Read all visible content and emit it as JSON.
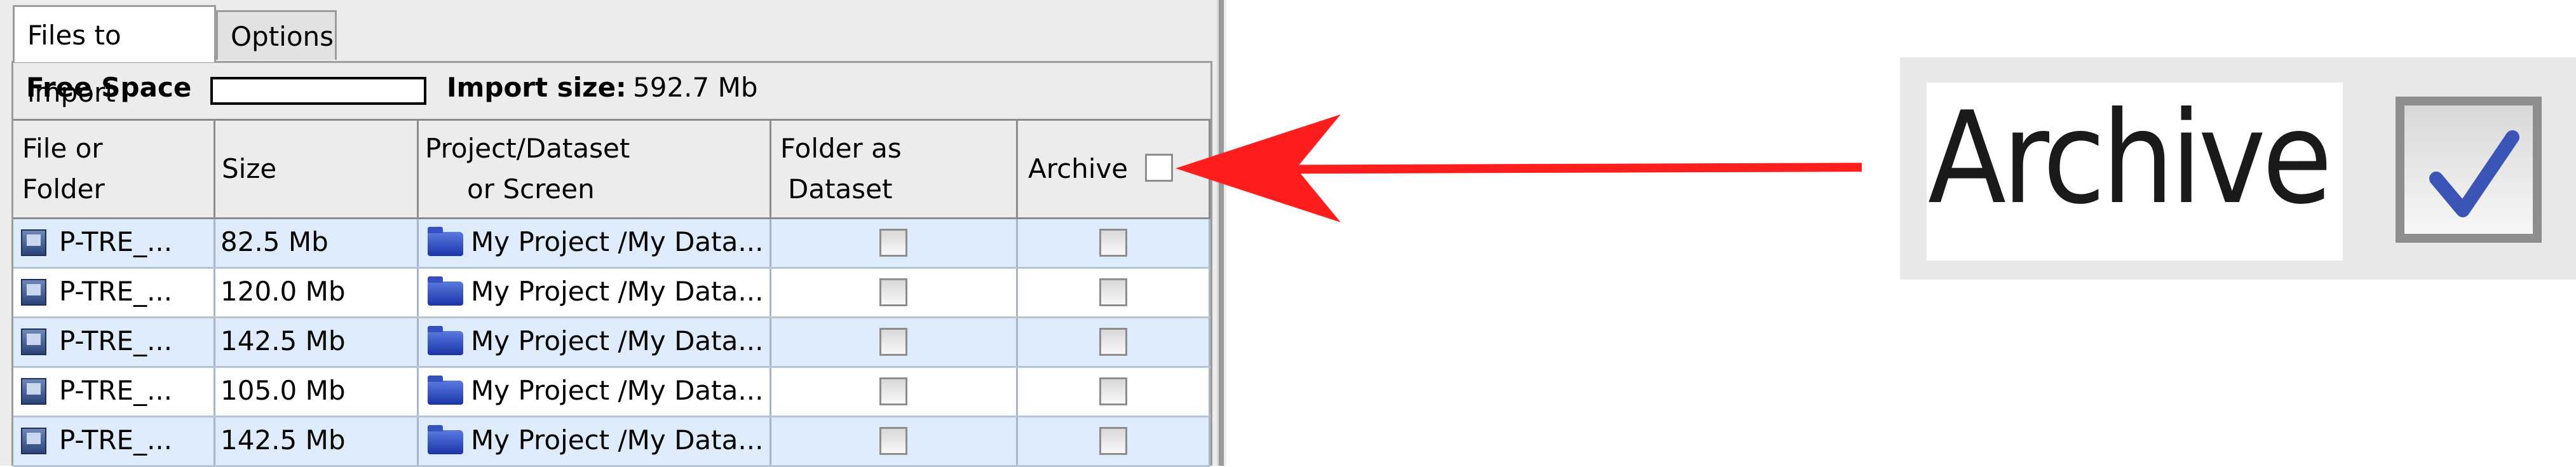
{
  "tabs": [
    {
      "label": "Files to import",
      "active": true
    },
    {
      "label": "Options",
      "active": false
    }
  ],
  "summary": {
    "free_space_label": "Free Space",
    "import_size_label": "Import size:",
    "import_size_value": "592.7 Mb"
  },
  "columns": {
    "file_line1": "File or",
    "file_line2": "Folder",
    "size": "Size",
    "project_line1": "Project/Dataset",
    "project_line2": "or Screen",
    "folder_line1": "Folder as",
    "folder_line2": "Dataset",
    "archive": "Archive"
  },
  "rows": [
    {
      "file": "P-TRE_...",
      "size": "82.5 Mb",
      "target": "My Project /My Data...",
      "folder_as_dataset": false,
      "archive": false
    },
    {
      "file": "P-TRE_...",
      "size": "120.0 Mb",
      "target": "My Project /My Data...",
      "folder_as_dataset": false,
      "archive": false
    },
    {
      "file": "P-TRE_...",
      "size": "142.5 Mb",
      "target": "My Project /My Data...",
      "folder_as_dataset": false,
      "archive": false
    },
    {
      "file": "P-TRE_...",
      "size": "105.0 Mb",
      "target": "My Project /My Data...",
      "folder_as_dataset": false,
      "archive": false
    },
    {
      "file": "P-TRE_...",
      "size": "142.5 Mb",
      "target": "My Project /My Data...",
      "folder_as_dataset": false,
      "archive": false
    }
  ],
  "header_archive_checked": false,
  "zoom": {
    "label": "Archive",
    "checked": true
  },
  "colors": {
    "arrow": "#ff1e1e",
    "row_alt": "#ddebfb",
    "check_mark": "#3a55b5"
  },
  "icons": {
    "file": "image-file-icon",
    "target": "folder-icon",
    "checkbox": "checkbox-icon",
    "arrow": "arrow-left-icon"
  }
}
